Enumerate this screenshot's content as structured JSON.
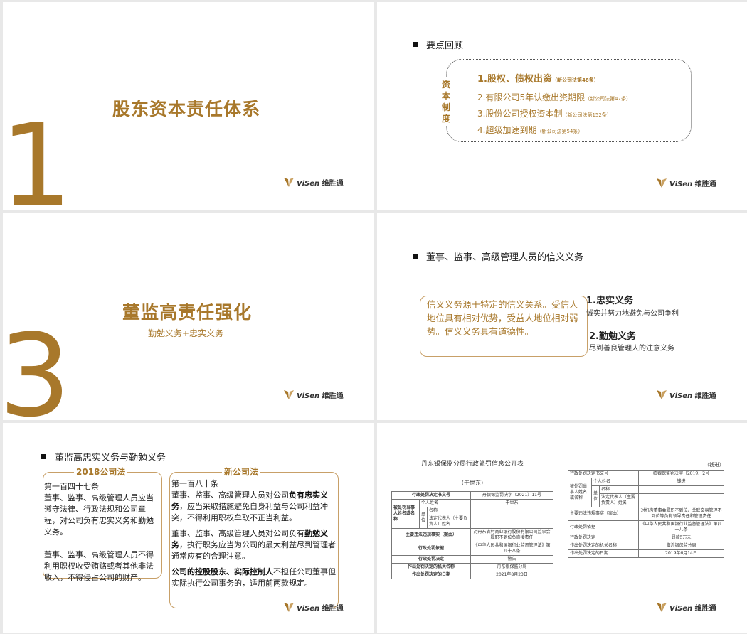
{
  "logo": {
    "vi": "ViSen",
    "cn": "维胜通"
  },
  "slide1": {
    "number": "1",
    "title": "股东资本责任体系"
  },
  "slide2": {
    "heading": "要点回顾",
    "vertical_label": [
      "资",
      "本",
      "制",
      "度"
    ],
    "points": [
      {
        "text": "1.股权、债权出资",
        "note": "（新公司法第48条）"
      },
      {
        "text": "2.有限公司5年认缴出资期限",
        "note": "（新公司法第47条）"
      },
      {
        "text": "3.股份公司授权资本制",
        "note": "（新公司法第152条）"
      },
      {
        "text": "4.超级加速到期",
        "note": "（新公司法第54条）"
      }
    ]
  },
  "slide3": {
    "number": "3",
    "title": "董监高责任强化",
    "subtitle": "勤勉义务+忠实义务"
  },
  "slide4": {
    "heading": "董事、监事、高级管理人员的信义义务",
    "card_text": "信义义务源于特定的信义关系。受信人地位具有相对优势，受益人地位相对弱势。信义义务具有道德性。",
    "duty1_title": "1.忠实义务",
    "duty1_desc": "诚实并努力地避免与公司争利",
    "duty2_title": "2.勤勉义务",
    "duty2_desc": "尽到善良管理人的注意义务"
  },
  "slide5": {
    "heading": "董监高忠实义务与勤勉义务",
    "old_law": {
      "title": "2018公司法",
      "article": "第一百四十七条",
      "p1": "董事、监事、高级管理人员应当遵守法律、行政法规和公司章程，对公司负有忠实义务和勤勉义务。",
      "p2": "董事、监事、高级管理人员不得利用职权收受贿赂或者其他非法收入，不得侵占公司的财产。"
    },
    "new_law": {
      "title": "新公司法",
      "article": "第一百八十条",
      "p1_a": "董事、监事、高级管理人员对公司",
      "p1_b": "负有忠实义务",
      "p1_c": "，应当采取措施避免自身利益与公司利益冲突，不得利用职权牟取不正当利益。",
      "p2_a": "董事、监事、高级管理人员对公司负有",
      "p2_b": "勤勉义务",
      "p2_c": "，执行职务应当为公司的最大利益尽到管理者通常应有的合理注意。",
      "p3_a": "公司的控股股东、实际控制人",
      "p3_b": "不担任公司董事但实际执行公司事务的，适用前两款规定。"
    }
  },
  "slide6": {
    "doc1": {
      "title": "丹东银保监分局行政处罚信息公开表",
      "subtitle": "（于世东）",
      "rows": [
        [
          "行政处罚决定书文号",
          "丹银保监罚决字〔2021〕11号"
        ],
        [
          "个人姓名",
          "于世东"
        ],
        [
          "名称",
          ""
        ],
        [
          "法定代表人（主要负责人）姓名",
          ""
        ],
        [
          "主要违法违规事实（案由）",
          "对丹东农村商业银行股份有限公司监事会履职不到位负直接责任"
        ],
        [
          "行政处罚依据",
          "《中华人民共和国银行业监督管理法》第四十八条"
        ],
        [
          "行政处罚决定",
          "警告"
        ],
        [
          "作出处罚决定的机关名称",
          "丹东银保监分局"
        ],
        [
          "作出处罚决定的日期",
          "2021年8月23日"
        ]
      ],
      "party_label": "被处罚当事人姓名或名称",
      "unit_label": "单位"
    },
    "doc2": {
      "top_note": "（钱进）",
      "rows": [
        [
          "行政处罚决定书文号",
          "临银保监罚决字〔2019〕2号"
        ],
        [
          "个人姓名",
          "钱进"
        ],
        [
          "名称",
          ""
        ],
        [
          "法定代表人（主要负责人）姓名",
          ""
        ],
        [
          "主要违法违规事实（案由）",
          "对机构董事会履职不到位、关联交易管理不到位等负有领导责任和管理责任"
        ],
        [
          "行政处罚依据",
          "《中华人民共和国银行业监督管理法》第四十八条"
        ],
        [
          "行政处罚决定",
          "罚款5万元"
        ],
        [
          "作出处罚决定的机关名称",
          "临沂银保监分局"
        ],
        [
          "作出处罚决定的日期",
          "2019年6月14日"
        ]
      ],
      "party_label": "被处罚当事人姓名或名称",
      "unit_label": "单位"
    }
  }
}
